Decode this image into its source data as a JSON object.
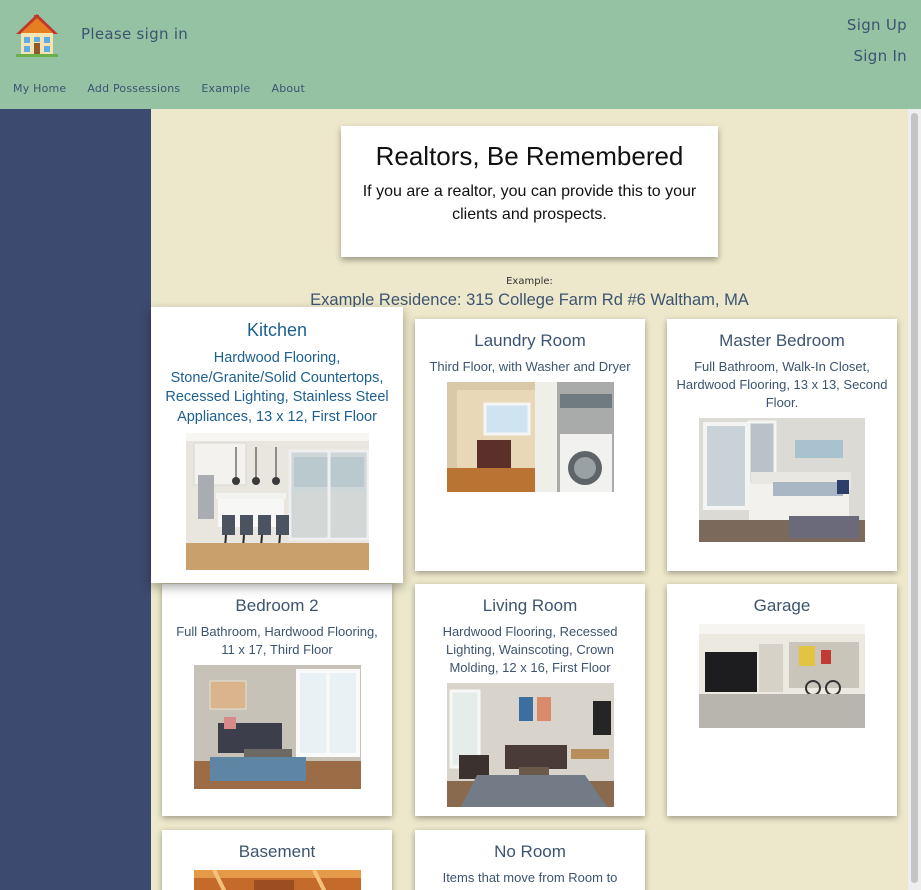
{
  "header": {
    "status": "Please sign in",
    "sign_up": "Sign Up",
    "sign_in": "Sign In",
    "logo_icon": "house-icon",
    "nav": [
      "My Home",
      "Add Possessions",
      "Example",
      "About"
    ]
  },
  "banner": {
    "title": "Realtors, Be Remembered",
    "text": "If you are a realtor, you can provide this to your clients and prospects."
  },
  "example_label": "Example:",
  "residence": "Example Residence: 315 College Farm Rd #6 Waltham, MA",
  "rooms": [
    {
      "name": "Kitchen",
      "description": "Hardwood Flooring, Stone/Granite/Solid Countertops, Recessed Lighting, Stainless Steel Appliances, 13 x 12, First Floor"
    },
    {
      "name": "Laundry Room",
      "description": "Third Floor, with Washer and Dryer"
    },
    {
      "name": "Master Bedroom",
      "description": "Full Bathroom, Walk-In Closet, Hardwood Flooring, 13 x 13, Second Floor."
    },
    {
      "name": "Bedroom 2",
      "description": "Full Bathroom, Hardwood Flooring, 11 x 17, Third Floor"
    },
    {
      "name": "Living Room",
      "description": "Hardwood Flooring, Recessed Lighting, Wainscoting, Crown Molding, 12 x 16, First Floor"
    },
    {
      "name": "Garage",
      "description": ""
    },
    {
      "name": "Basement",
      "description": ""
    },
    {
      "name": "No Room",
      "description": "Items that move from Room to"
    }
  ],
  "colors": {
    "header_bg": "#94c2a3",
    "sidebar_bg": "#3c4a70",
    "content_bg": "#ede8cb",
    "text": "#3d5470",
    "featured_text": "#1d5f8f"
  }
}
